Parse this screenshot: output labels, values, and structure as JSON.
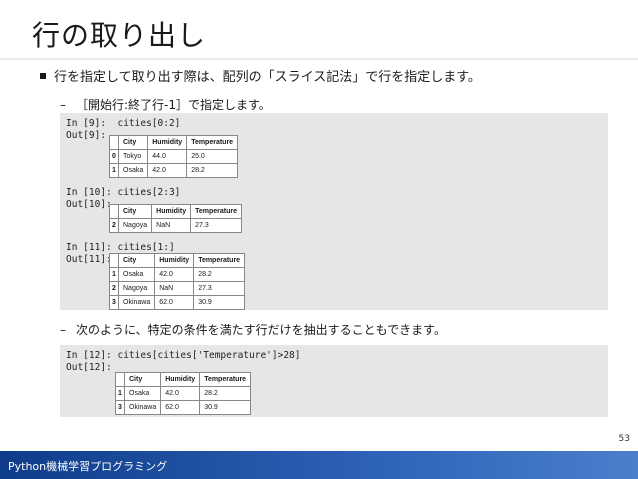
{
  "title": "行の取り出し",
  "bullet": "行を指定して取り出す際は、配列の「スライス記法」で行を指定します。",
  "sub1": {
    "dash": "–",
    "text": "［開始行:終了行-1］で指定します。"
  },
  "sub2": {
    "dash": "–",
    "text": "次のように、特定の条件を満たす行だけを抽出することもできます。"
  },
  "cells": [
    {
      "in": "In [9]:  cities[0:2]",
      "out": "Out[9]:",
      "headers": [
        "",
        "City",
        "Humidity",
        "Temperature"
      ],
      "rows": [
        [
          "0",
          "Tokyo",
          "44.0",
          "25.0"
        ],
        [
          "1",
          "Osaka",
          "42.0",
          "28.2"
        ]
      ]
    },
    {
      "in": "In [10]: cities[2:3]",
      "out": "Out[10]:",
      "headers": [
        "",
        "City",
        "Humidity",
        "Temperature"
      ],
      "rows": [
        [
          "2",
          "Nagoya",
          "NaN",
          "27.3"
        ]
      ]
    },
    {
      "in": "In [11]: cities[1:]",
      "out": "Out[11]:",
      "headers": [
        "",
        "City",
        "Humidity",
        "Temperature"
      ],
      "rows": [
        [
          "1",
          "Osaka",
          "42.0",
          "28.2"
        ],
        [
          "2",
          "Nagoya",
          "NaN",
          "27.3"
        ],
        [
          "3",
          "Okinawa",
          "62.0",
          "30.9"
        ]
      ]
    },
    {
      "in": "In [12]: cities[cities['Temperature']>28]",
      "out": "Out[12]:",
      "headers": [
        "",
        "City",
        "Humidity",
        "Temperature"
      ],
      "rows": [
        [
          "1",
          "Osaka",
          "42.0",
          "28.2"
        ],
        [
          "3",
          "Okinawa",
          "62.0",
          "30.9"
        ]
      ]
    }
  ],
  "page_number": "53",
  "footer": "Python機械学習プログラミング",
  "colors": {
    "footer_start": "#0f3c8a",
    "footer_end": "#4b7fcc",
    "code_bg": "#e6e6e6"
  }
}
